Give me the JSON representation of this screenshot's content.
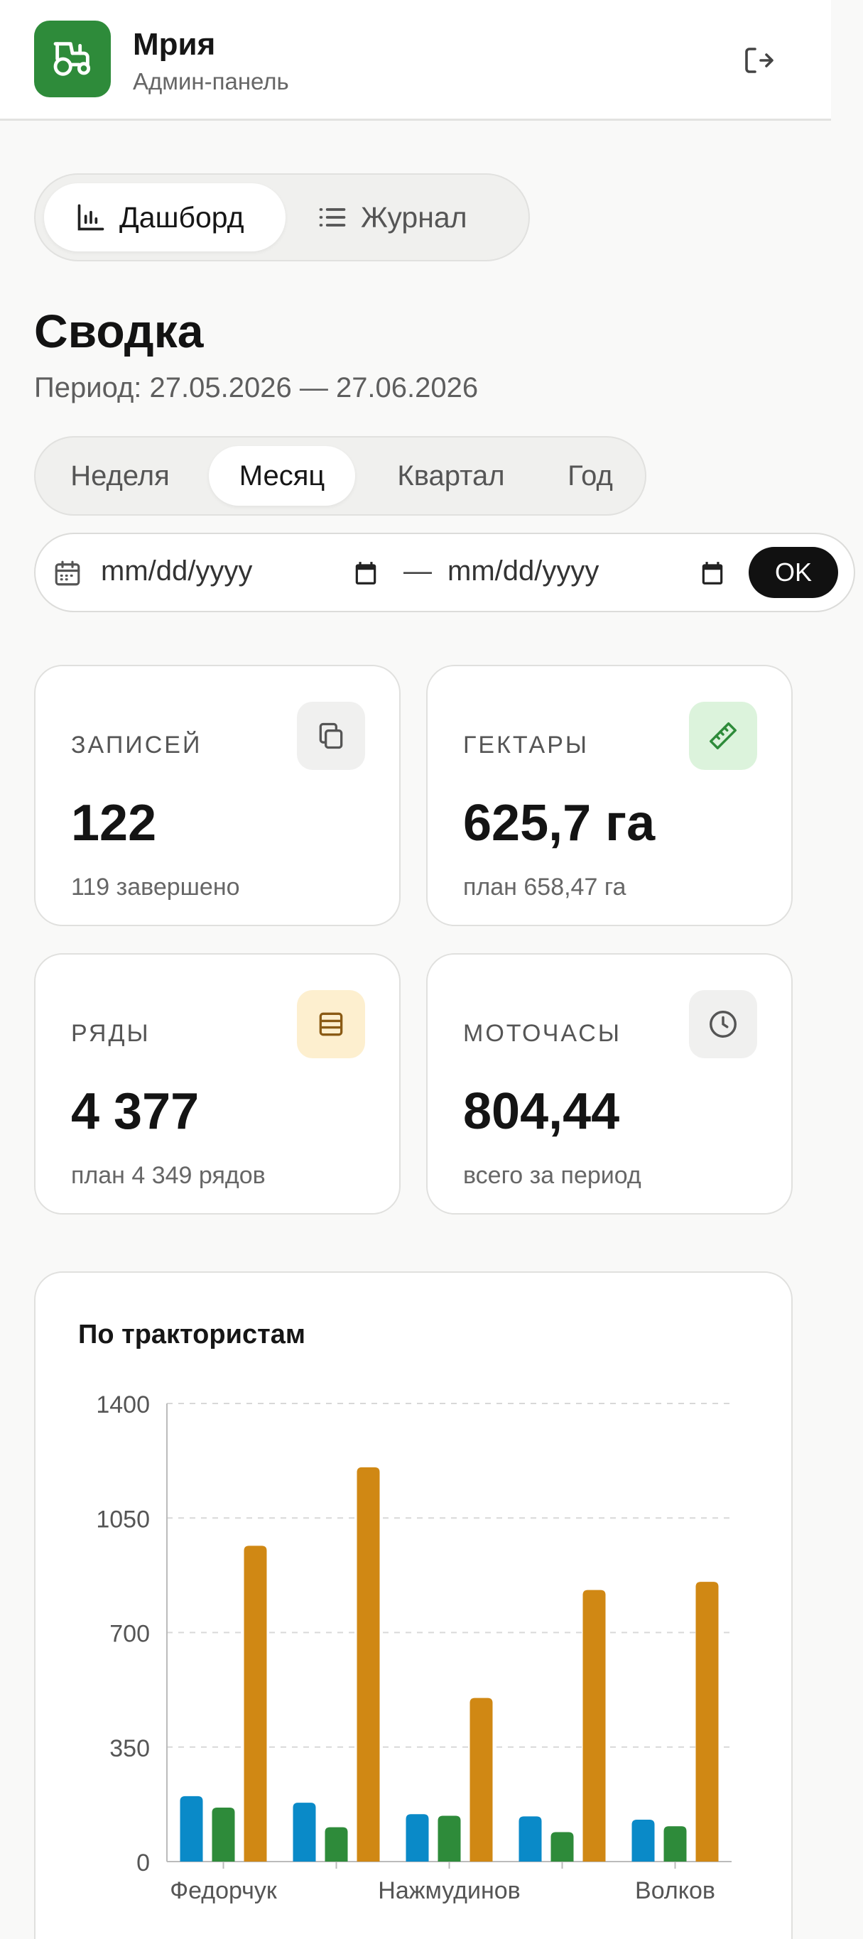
{
  "header": {
    "app_title": "Мрия",
    "app_subtitle": "Админ-панель",
    "logo_icon": "tractor-icon",
    "logout_icon": "logout-icon"
  },
  "nav": {
    "tabs": [
      {
        "label": "Дашборд",
        "icon": "bar-chart-icon",
        "active": true
      },
      {
        "label": "Журнал",
        "icon": "list-icon",
        "active": false
      }
    ]
  },
  "summary": {
    "title": "Сводка",
    "period": "Период: 27.05.2026 — 27.06.2026"
  },
  "period_selector": {
    "options": [
      "Неделя",
      "Месяц",
      "Квартал",
      "Год"
    ],
    "selected": "Месяц"
  },
  "date_range": {
    "from_placeholder": "mm/dd/yyyy",
    "to_placeholder": "mm/dd/yyyy",
    "separator": "—",
    "ok_label": "OK"
  },
  "stats": [
    {
      "label": "ЗАПИСЕЙ",
      "value": "122",
      "sub": "119 завершено",
      "icon": "copy-icon",
      "icon_bg": "#f0f0ef",
      "icon_color": "#555555"
    },
    {
      "label": "ГЕКТАРЫ",
      "value": "625,7 га",
      "sub": "план 658,47 га",
      "icon": "ruler-icon",
      "icon_bg": "#dcf3dc",
      "icon_color": "#2e8b3a"
    },
    {
      "label": "РЯДЫ",
      "value": "4 377",
      "sub": "план 4 349 рядов",
      "icon": "rows-icon",
      "icon_bg": "#fdefcf",
      "icon_color": "#8a5a14"
    },
    {
      "label": "МОТОЧАСЫ",
      "value": "804,44",
      "sub": "всего за период",
      "icon": "clock-icon",
      "icon_bg": "#f0f0ef",
      "icon_color": "#555555"
    }
  ],
  "chart_data": {
    "type": "bar",
    "title": "По трактористам",
    "categories": [
      "Федорчук",
      "",
      "Нажмудинов",
      "",
      "Волков"
    ],
    "series": [
      {
        "color": "#0a8ac8",
        "values": [
          200,
          180,
          145,
          138,
          128
        ]
      },
      {
        "color": "#2e8b3a",
        "values": [
          165,
          105,
          140,
          90,
          108
        ]
      },
      {
        "color": "#d08814",
        "values": [
          965,
          1205,
          500,
          830,
          855
        ]
      }
    ],
    "yticks": [
      0,
      350,
      700,
      1050,
      1400
    ],
    "ylim": [
      0,
      1400
    ],
    "grid": true
  }
}
